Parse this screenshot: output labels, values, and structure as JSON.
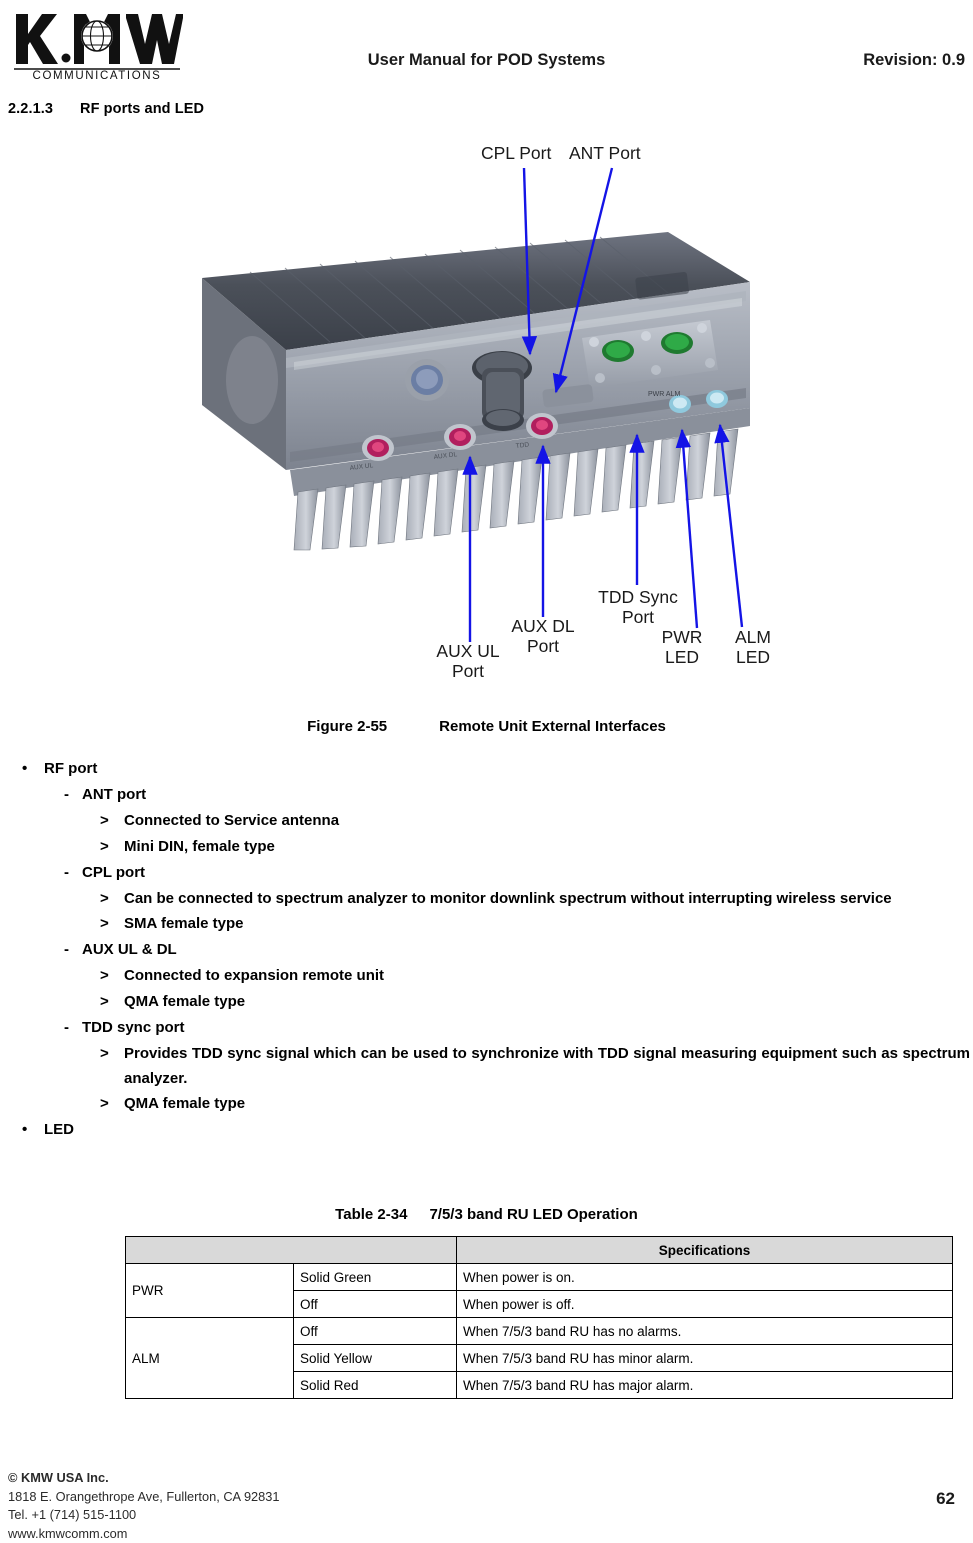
{
  "header": {
    "logo_top": "KMW",
    "logo_bottom": "COMMUNICATIONS",
    "title": "User Manual for POD Systems",
    "revision": "Revision: 0.9"
  },
  "section": {
    "number": "2.2.1.3",
    "title": "RF ports and LED"
  },
  "figure": {
    "callouts": {
      "cpl_port": "CPL Port",
      "ant_port": "ANT Port",
      "aux_ul_port": "AUX UL Port",
      "aux_dl_port": "AUX DL Port",
      "tdd_sync_port": "TDD Sync Port",
      "pwr_led": "PWR LED",
      "alm_led": "ALM LED"
    },
    "caption_number": "Figure 2-55",
    "caption_text": "Remote Unit External Interfaces"
  },
  "content": {
    "rf_port": "RF port",
    "ant_port": "ANT port",
    "ant_port_b1": "Connected to Service antenna",
    "ant_port_b2": "Mini DIN, female type",
    "cpl_port": "CPL port",
    "cpl_port_b1": "Can be connected to spectrum analyzer to monitor downlink spectrum without interrupting wireless service",
    "cpl_port_b2": "SMA female type",
    "aux_ul_dl": "AUX UL & DL",
    "aux_b1": "Connected to expansion remote unit",
    "aux_b2": "QMA female type",
    "tdd_sync_port": "TDD sync port",
    "tdd_b1": "Provides TDD sync signal which can be used to synchronize with TDD signal measuring equipment such as spectrum analyzer.",
    "tdd_b2": "QMA female type",
    "led": "LED"
  },
  "table": {
    "title_number": "Table 2-34",
    "title_text": "7/5/3 band RU LED Operation",
    "headers": [
      "",
      "Specifications"
    ],
    "rows": [
      {
        "led": "PWR",
        "state": "Solid Green",
        "spec": "When power is on."
      },
      {
        "led": "",
        "state": "Off",
        "spec": "When power is off."
      },
      {
        "led": "ALM",
        "state": "Off",
        "spec": "When 7/5/3 band RU has no alarms."
      },
      {
        "led": "",
        "state": "Solid Yellow",
        "spec": "When 7/5/3 band RU has minor alarm."
      },
      {
        "led": "",
        "state": "Solid Red",
        "spec": "When 7/5/3 band RU has major alarm."
      }
    ]
  },
  "footer": {
    "line1": "© KMW USA Inc.",
    "line2": "1818 E. Orangethrope Ave, Fullerton, CA 92831",
    "line3": "Tel. +1 (714) 515-1100",
    "line4": "www.kmwcomm.com",
    "page_number": "62"
  }
}
